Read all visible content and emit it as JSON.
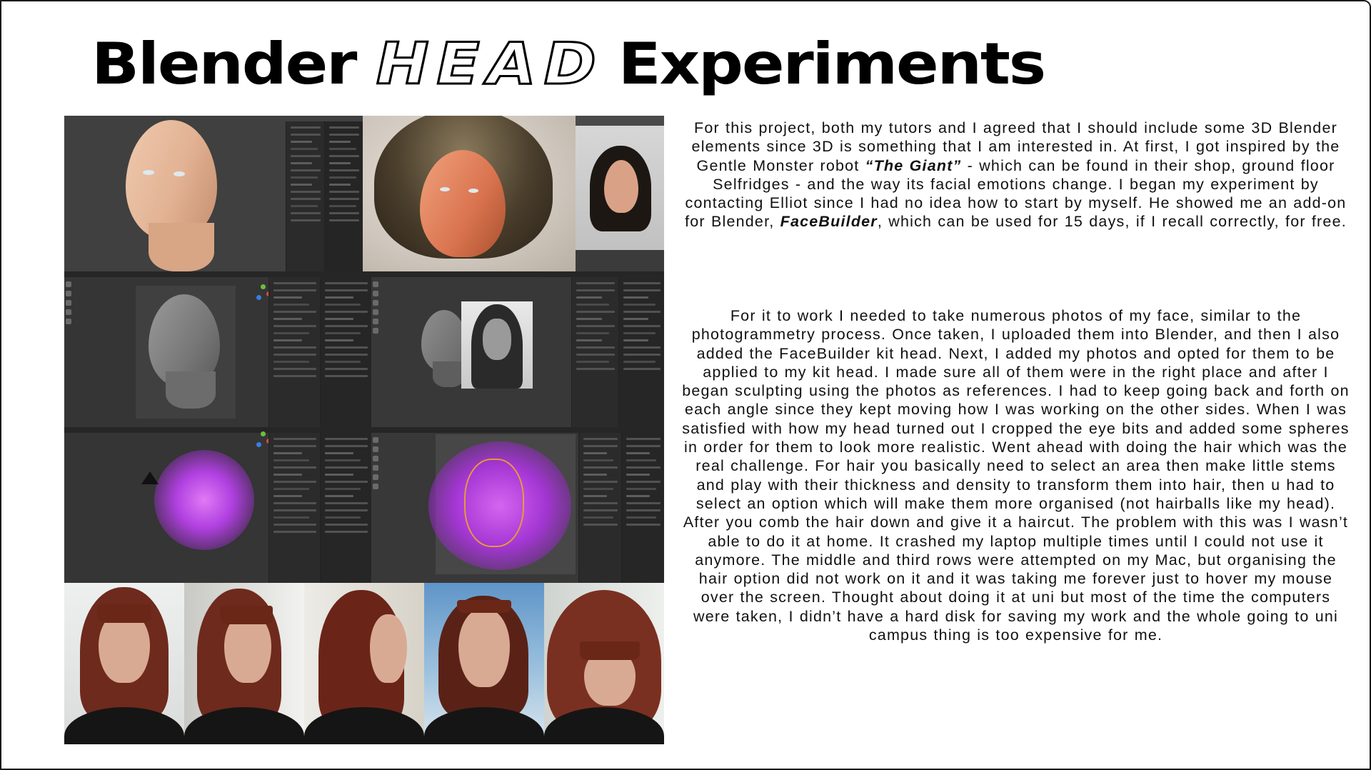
{
  "title": {
    "part1": "Blender",
    "part2": "HEAD",
    "part3": "Experiments"
  },
  "paragraph1": {
    "text_a": "For this project, both my tutors and I agreed that I should include some 3D Blender elements since 3D is something that I am interested in. At first, I got inspired by the Gentle Monster robot ",
    "emph_a": "“The Giant”",
    "text_b": " - which can be found in their shop, ground floor Selfridges - and the way its facial emotions change. I began my experiment by contacting Elliot since I had no idea how to start by myself. He showed me an add-on for Blender, ",
    "emph_b": "FaceBuilder",
    "text_c": ", which can be used for 15 days, if I recall correctly, for free."
  },
  "paragraph2": {
    "text": "For it to work I needed to take numerous photos of my face, similar to the photogrammetry process. Once taken, I uploaded them into Blender, and then I also added the FaceBuilder kit head. Next, I added my photos and opted for them to be applied to my kit head. I made sure all of them were in the right place and after I began sculpting using the photos as references. I had to keep going back and forth on each angle since they kept moving how I was working on the other sides. When I was satisfied with how my head turned out I cropped the eye bits and added some spheres in order for them to look more realistic. Went ahead with doing the hair which was the real challenge. For hair you basically need to select an area then make little stems and play with their thickness and density to transform them into hair, then u had to select an option which will make them more organised (not hairballs like my head). After you comb the hair down and give it a haircut. The problem with this was I wasn’t able to do it at home. It crashed my laptop multiple times until I could not use it anymore. The middle and third rows were attempted on my Mac, but organising the hair option did not work on it and it was taking me forever just to hover my mouse over the screen. Thought about doing it at uni but most of the time the computers were taken, I didn’t have a hard disk for saving my work and the whole going to uni campus thing is too expensive for me."
  },
  "colors": {
    "text": "#111111",
    "background": "#ffffff",
    "accent_hair": "#6e2a1c",
    "accent_magenta": "#b040e0"
  }
}
